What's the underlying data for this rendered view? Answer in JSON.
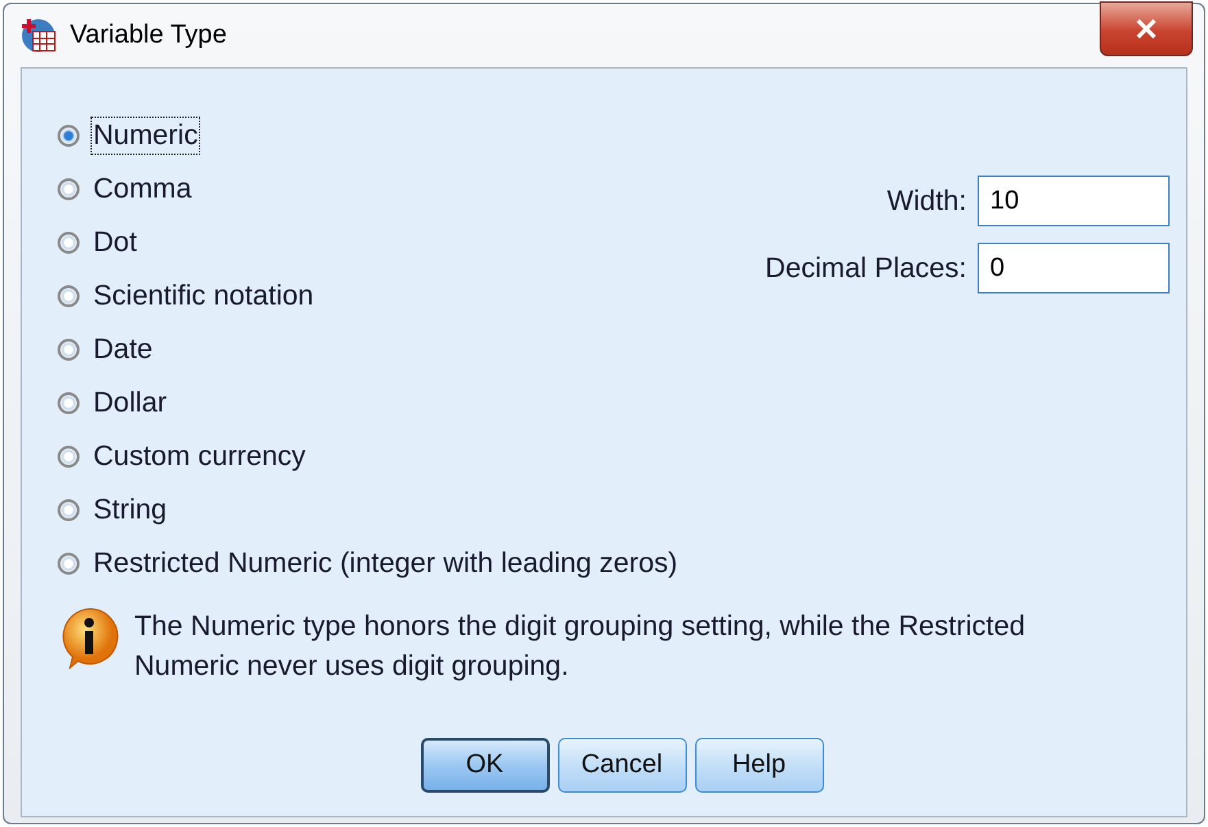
{
  "window": {
    "title": "Variable Type"
  },
  "types": [
    {
      "label": "Numeric",
      "selected": true,
      "focused": true
    },
    {
      "label": "Comma",
      "selected": false,
      "focused": false
    },
    {
      "label": "Dot",
      "selected": false,
      "focused": false
    },
    {
      "label": "Scientific notation",
      "selected": false,
      "focused": false
    },
    {
      "label": "Date",
      "selected": false,
      "focused": false
    },
    {
      "label": "Dollar",
      "selected": false,
      "focused": false
    },
    {
      "label": "Custom currency",
      "selected": false,
      "focused": false
    },
    {
      "label": "String",
      "selected": false,
      "focused": false
    },
    {
      "label": "Restricted Numeric (integer with leading zeros)",
      "selected": false,
      "focused": false
    }
  ],
  "fields": [
    {
      "label": "Width:",
      "value": "10"
    },
    {
      "label": "Decimal Places:",
      "value": "0"
    }
  ],
  "info": "The Numeric type honors the digit grouping setting, while the Restricted Numeric never uses digit grouping.",
  "buttons": [
    {
      "label": "OK",
      "default": true
    },
    {
      "label": "Cancel",
      "default": false
    },
    {
      "label": "Help",
      "default": false
    }
  ]
}
